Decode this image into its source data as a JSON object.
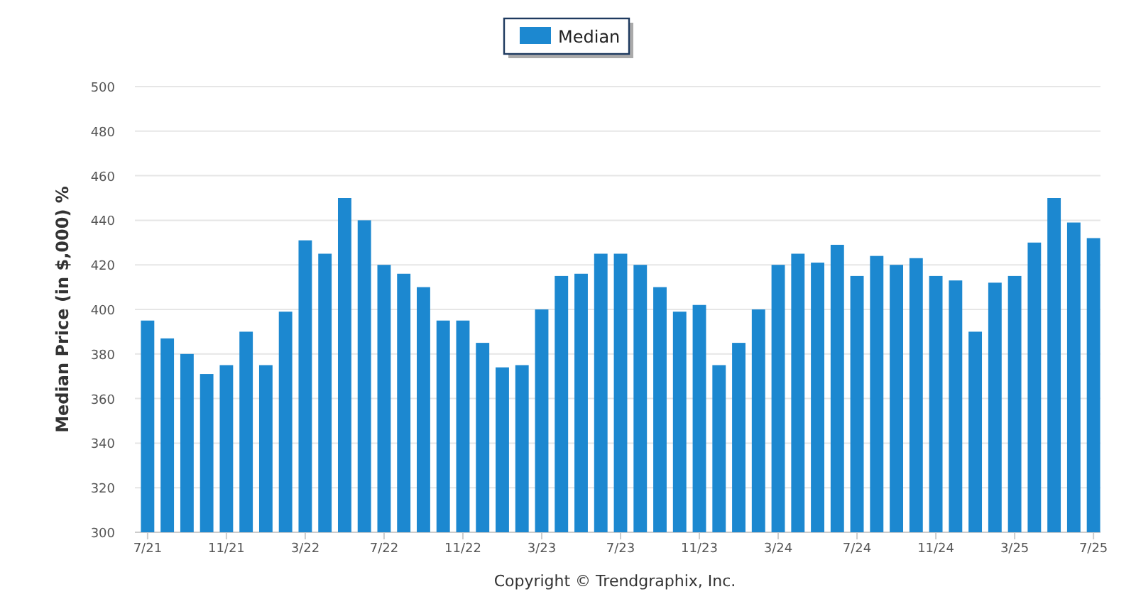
{
  "chart": {
    "chart_data": {
      "type": "bar",
      "ylabel": "Median Price (in $,000) %",
      "grid": true,
      "categories": [
        "7/21",
        null,
        null,
        null,
        "11/21",
        null,
        null,
        null,
        "3/22",
        null,
        null,
        null,
        "7/22",
        null,
        null,
        null,
        "11/22",
        null,
        null,
        null,
        "3/23",
        null,
        null,
        null,
        "7/23",
        null,
        null,
        null,
        "11/23",
        null,
        null,
        null,
        "3/24",
        null,
        null,
        null,
        "7/24",
        null,
        null,
        null,
        "11/24",
        null,
        null,
        null,
        "3/25",
        null,
        null,
        null,
        "7/25"
      ],
      "series": [
        {
          "name": "Median",
          "color": "#1c88d0",
          "values": [
            395,
            387,
            380,
            371,
            375,
            390,
            375,
            399,
            431,
            425,
            450,
            440,
            420,
            416,
            410,
            395,
            395,
            385,
            374,
            375,
            400,
            415,
            416,
            425,
            425,
            420,
            410,
            399,
            402,
            375,
            385,
            400,
            420,
            425,
            421,
            429,
            415,
            424,
            420,
            423,
            415,
            413,
            390,
            412,
            415,
            430,
            450,
            439,
            432
          ]
        }
      ],
      "ylim": [
        300,
        500
      ],
      "yticks": [
        300,
        320,
        340,
        360,
        380,
        400,
        420,
        440,
        460,
        480,
        500
      ]
    },
    "footer": "Copyright © Trendgraphix, Inc."
  }
}
